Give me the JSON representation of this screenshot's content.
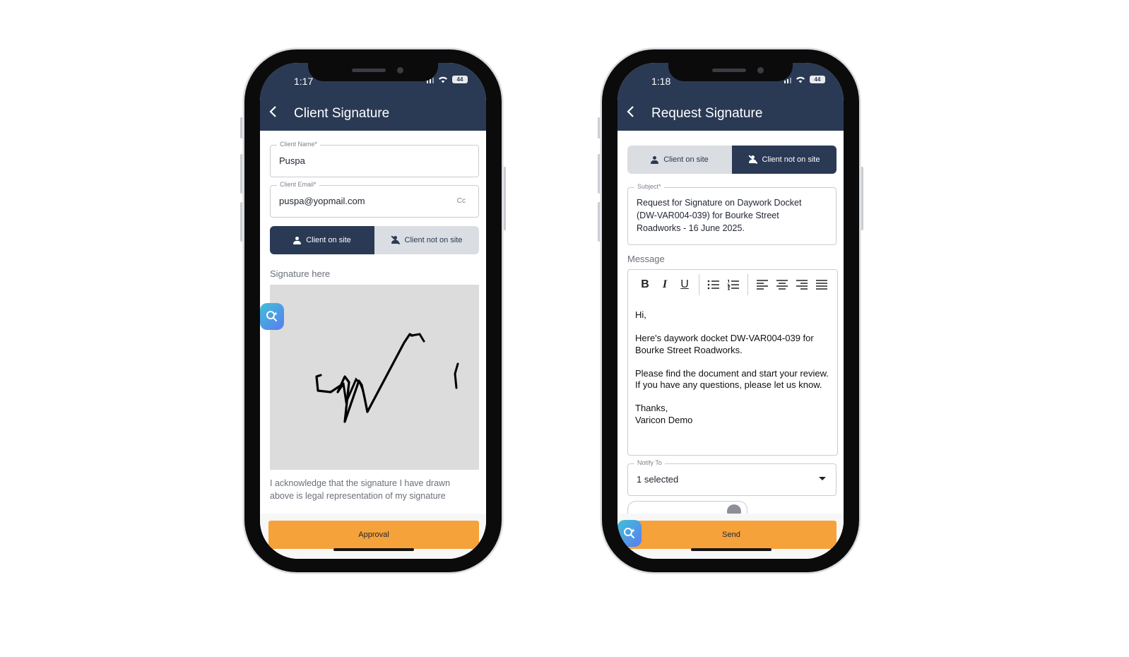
{
  "left_phone": {
    "status": {
      "time": "1:17",
      "battery": "44"
    },
    "header": {
      "title": "Client Signature"
    },
    "client_name": {
      "label": "Client Name*",
      "value": "Puspa"
    },
    "client_email": {
      "label": "Client Email*",
      "value": "puspa@yopmail.com",
      "cc": "Cc"
    },
    "toggle": {
      "on_site": "Client on site",
      "not_on_site": "Client not on site",
      "selected": "on_site"
    },
    "signature_label": "Signature here",
    "acknowledgement": "I acknowledge that the signature I have drawn above is legal representation of my signature",
    "primary_button": "Approval"
  },
  "right_phone": {
    "status": {
      "time": "1:18",
      "battery": "44"
    },
    "header": {
      "title": "Request Signature"
    },
    "toggle": {
      "on_site": "Client on site",
      "not_on_site": "Client not on site",
      "selected": "not_on_site"
    },
    "subject": {
      "label": "Subject*",
      "value": "Request for Signature on Daywork Docket (DW-VAR004-039) for Bourke Street Roadworks - 16 June 2025."
    },
    "message_label": "Message",
    "toolbar": {
      "bold": "B",
      "italic": "I",
      "underline": "U"
    },
    "message": {
      "greeting": "Hi,",
      "line1": "Here's daywork docket DW-VAR004-039 for Bourke Street Roadworks.",
      "line2": "Please find the document and start your review. If you have any questions, please let us know.",
      "sign_off_1": "Thanks,",
      "sign_off_2": "Varicon Demo"
    },
    "notify_to": {
      "label": "Notify To",
      "value": "1 selected"
    },
    "primary_button": "Send"
  },
  "colors": {
    "header": "#2a3a55",
    "primary": "#f5a23a",
    "toggle_off": "#dadde2",
    "signature_pad": "#dcdcdc"
  }
}
